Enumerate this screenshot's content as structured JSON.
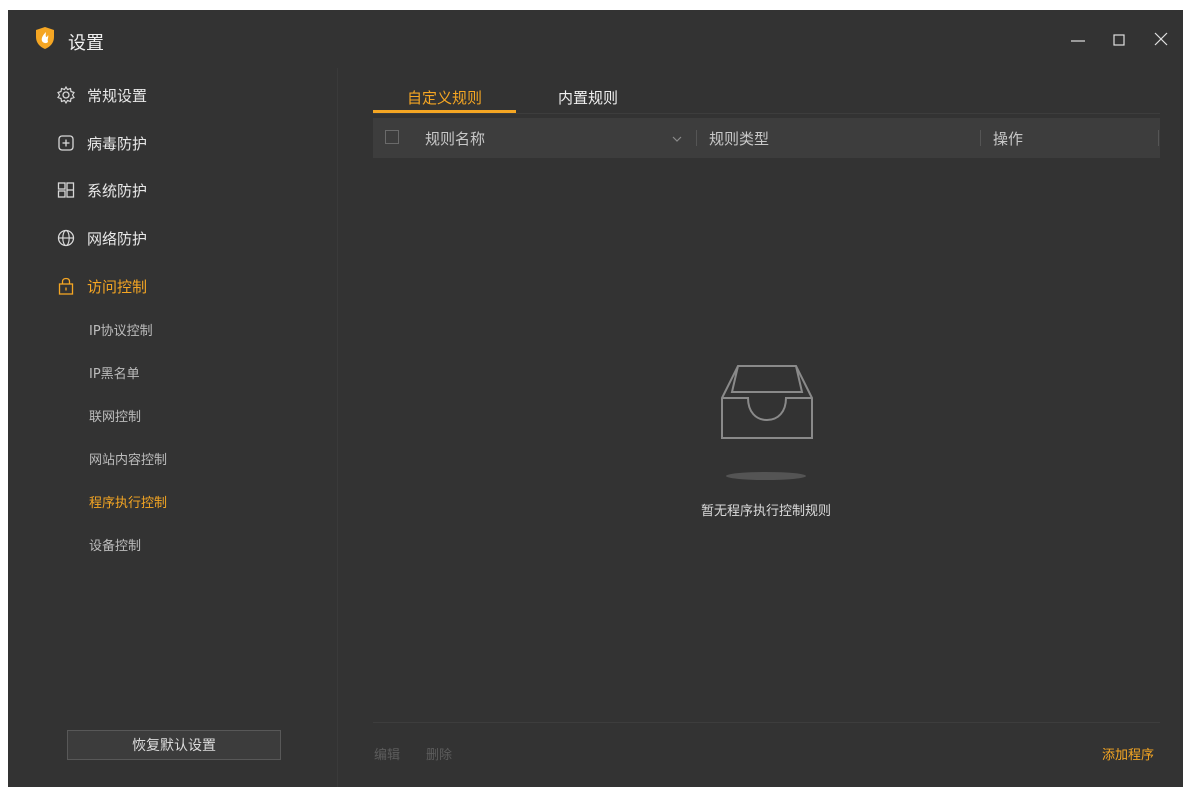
{
  "window": {
    "title": "设置",
    "accent_color": "#f5a623",
    "background_color": "#333333",
    "controls": [
      "minimize-icon",
      "maximize-icon",
      "close-icon"
    ]
  },
  "sidebar": {
    "items": [
      {
        "label": "常规设置",
        "icon": "gear-icon"
      },
      {
        "label": "病毒防护",
        "icon": "plus-box-icon"
      },
      {
        "label": "系统防护",
        "icon": "grid-icon"
      },
      {
        "label": "网络防护",
        "icon": "globe-icon"
      },
      {
        "label": "访问控制",
        "icon": "lock-icon",
        "active": true
      }
    ],
    "sub_items": [
      {
        "label": "IP协议控制"
      },
      {
        "label": "IP黑名单"
      },
      {
        "label": "联网控制"
      },
      {
        "label": "网站内容控制"
      },
      {
        "label": "程序执行控制",
        "active": true
      },
      {
        "label": "设备控制"
      }
    ],
    "restore_label": "恢复默认设置"
  },
  "main": {
    "tabs": [
      {
        "label": "自定义规则",
        "active": true
      },
      {
        "label": "内置规则"
      }
    ],
    "table": {
      "columns": [
        "规则名称",
        "规则类型",
        "操作"
      ]
    },
    "empty_text": "暂无程序执行控制规则",
    "footer": {
      "edit_label": "编辑",
      "delete_label": "删除",
      "add_label": "添加程序"
    }
  }
}
